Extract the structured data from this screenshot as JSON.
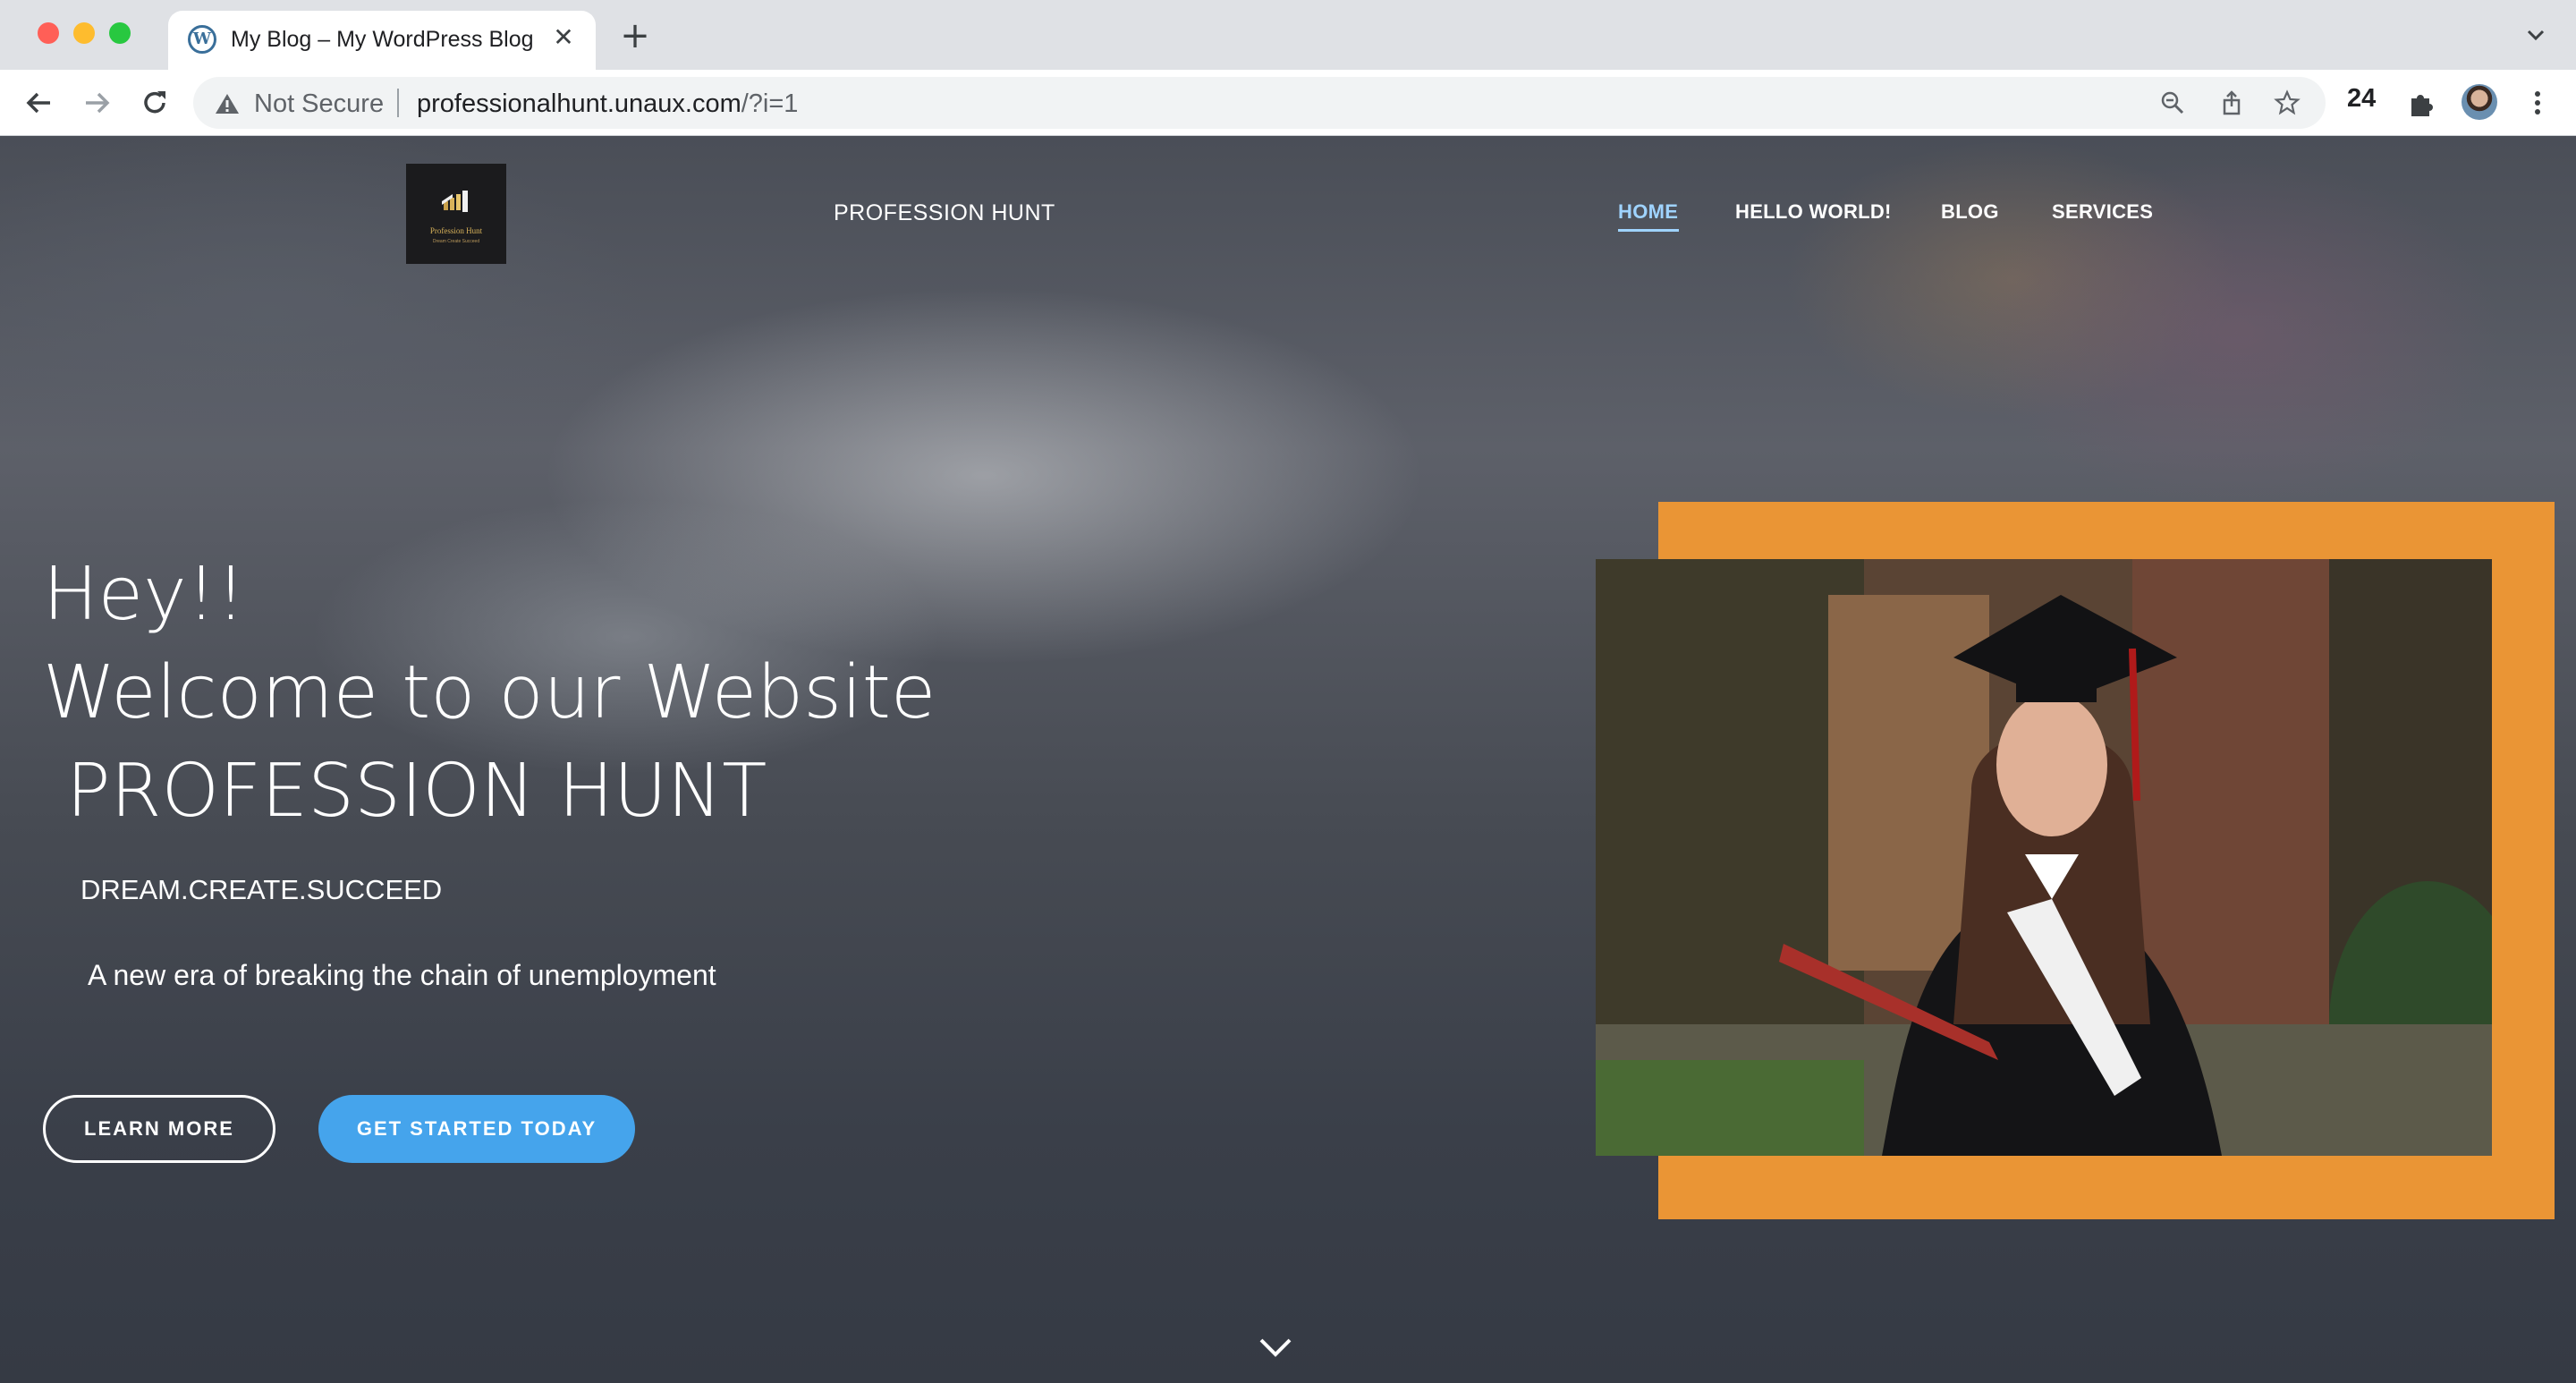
{
  "browser": {
    "tab": {
      "title": "My Blog – My WordPress Blog",
      "favicon": "wordpress-icon"
    },
    "address_bar": {
      "security_label": "Not Secure",
      "url_host": "professionalhunt.unaux.com",
      "url_path": "/?i=1"
    },
    "extensions_badge": "24"
  },
  "site": {
    "logo": {
      "name": "Profession Hunt",
      "tagline": "Dream Create Succeed"
    },
    "title": "PROFESSION HUNT",
    "nav": {
      "items": [
        {
          "label": "HOME",
          "active": true
        },
        {
          "label": "HELLO WORLD!"
        },
        {
          "label": "BLOG"
        },
        {
          "label": "SERVICES"
        }
      ]
    },
    "hero": {
      "line1": "Hey!!",
      "line2": "Welcome to our Website",
      "line3": " PROFESSION HUNT",
      "tagline": "DREAM.CREATE.SUCCEED",
      "subtitle": "A new era of breaking the chain of unemployment",
      "learn_more_label": "LEARN MORE",
      "get_started_label": "GET STARTED TODAY"
    }
  },
  "colors": {
    "accent_orange": "#ea9535",
    "button_blue": "#45a4ec",
    "nav_active": "#9fd3ff"
  }
}
